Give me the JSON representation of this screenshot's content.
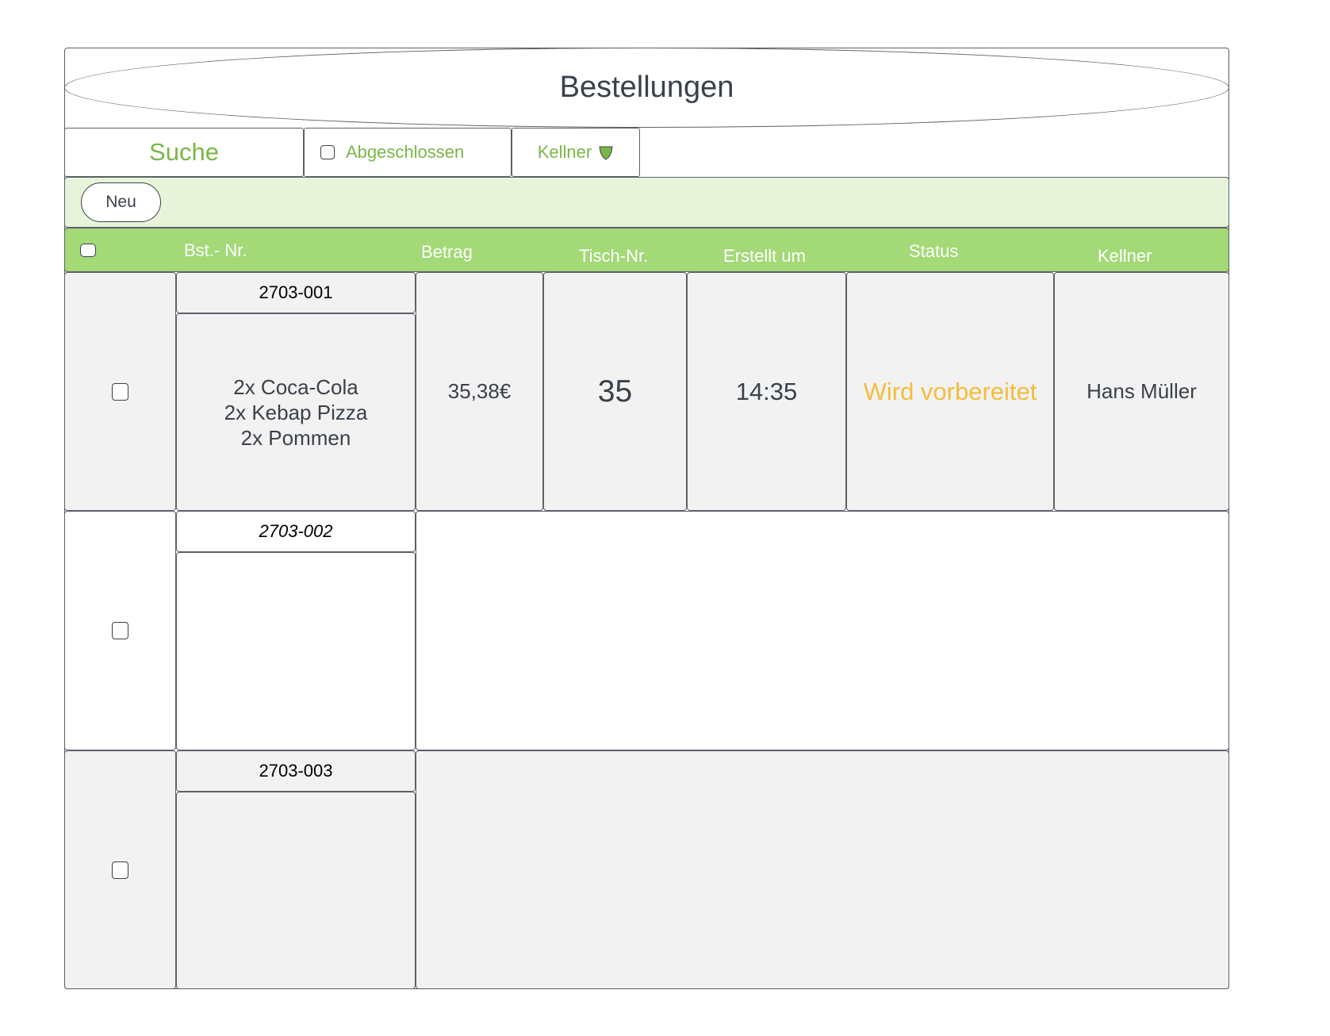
{
  "title": "Bestellungen",
  "filters": {
    "search_label": "Suche",
    "completed_label": "Abgeschlossen",
    "waiter_label": "Kellner"
  },
  "toolbar": {
    "new_label": "Neu"
  },
  "columns": {
    "order_no": "Bst.- Nr.",
    "amount": "Betrag",
    "table_no": "Tisch-Nr.",
    "created_at": "Erstellt um",
    "status": "Status",
    "waiter": "Kellner"
  },
  "orders": [
    {
      "order_no": "2703-001",
      "items": "2x Coca-Cola\n2x Kebap Pizza\n2x Pommen",
      "amount": "35,38€",
      "table_no": "35",
      "created_at": "14:35",
      "status": "Wird vorbereitet",
      "waiter": "Hans Müller"
    },
    {
      "order_no": "2703-002"
    },
    {
      "order_no": "2703-003"
    }
  ],
  "colors": {
    "accent_green": "#7ab648",
    "header_green": "#a3d977",
    "toolbar_green": "#e8f4da",
    "status_orange": "#f5bd3c"
  },
  "icons": {
    "waiter_dropdown": "shield-dropdown-icon"
  }
}
